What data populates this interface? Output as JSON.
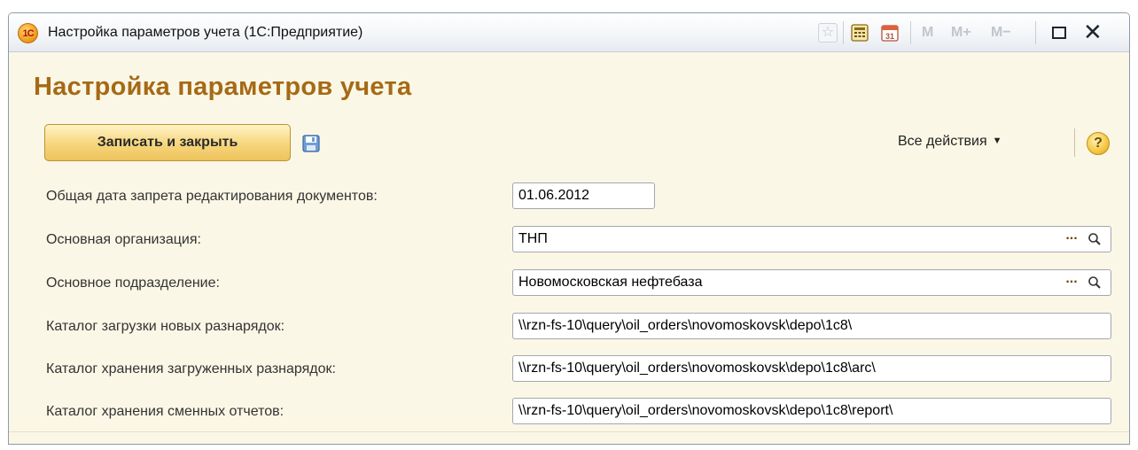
{
  "window": {
    "logo_text": "1С",
    "title": "Настройка параметров учета  (1С:Предприятие)",
    "toolbar": {
      "memory_labels": [
        "M",
        "M+",
        "M−"
      ]
    }
  },
  "form": {
    "title": "Настройка параметров учета",
    "save_close_label": "Записать и закрыть",
    "all_actions_label": "Все действия",
    "help_label": "?"
  },
  "fields": {
    "lock_date": {
      "label": "Общая дата запрета редактирования документов:",
      "value": "01.06.2012"
    },
    "organization": {
      "label": "Основная организация:",
      "value": "ТНП"
    },
    "department": {
      "label": "Основное подразделение:",
      "value": "Новомосковская нефтебаза"
    },
    "import_dir": {
      "label": "Каталог загрузки новых разнарядок:",
      "value": "\\\\rzn-fs-10\\query\\oil_orders\\novomoskovsk\\depo\\1c8\\"
    },
    "archive_dir": {
      "label": "Каталог хранения загруженных разнарядок:",
      "value": "\\\\rzn-fs-10\\query\\oil_orders\\novomoskovsk\\depo\\1c8\\arc\\"
    },
    "report_dir": {
      "label": "Каталог хранения сменных отчетов:",
      "value": "\\\\rzn-fs-10\\query\\oil_orders\\novomoskovsk\\depo\\1c8\\report\\"
    }
  },
  "select_button_label": "...",
  "colors": {
    "form_background": "#fbf7e6",
    "title_color": "#a56a16",
    "button_accent": "#f6d67c"
  }
}
